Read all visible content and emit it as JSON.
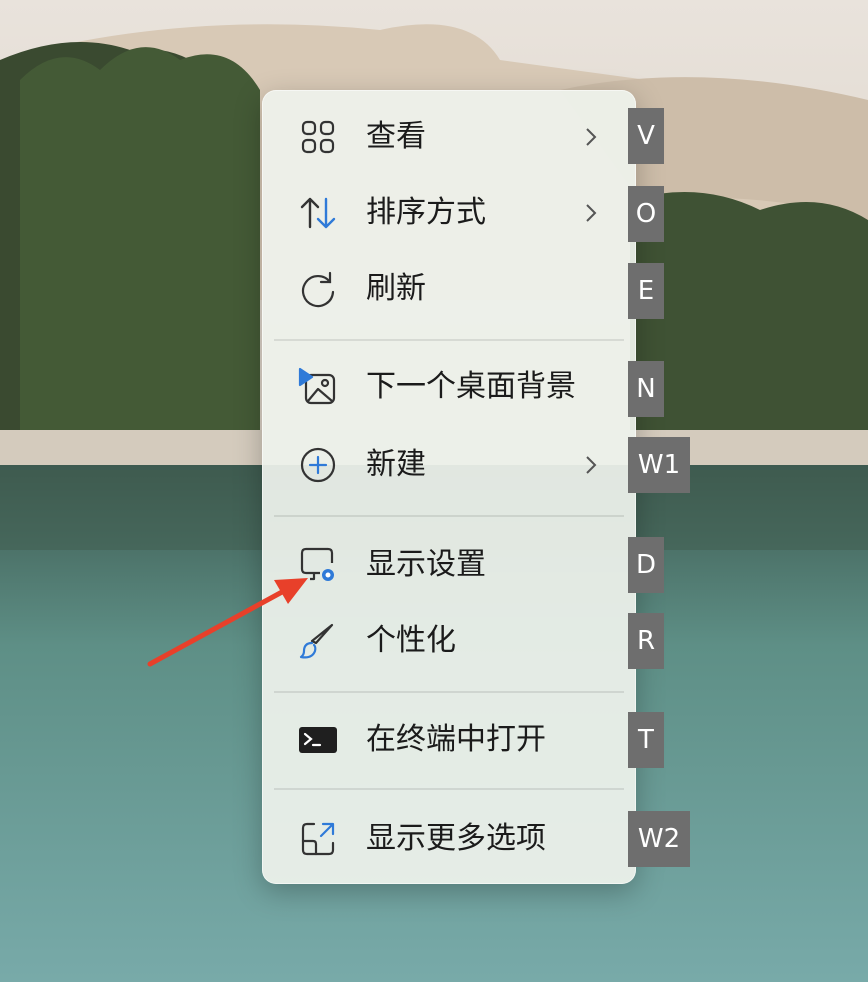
{
  "menu": {
    "items": [
      {
        "label": "查看",
        "icon": "grid-view-icon",
        "submenu": true,
        "key": "V"
      },
      {
        "label": "排序方式",
        "icon": "sort-icon",
        "submenu": true,
        "key": "O"
      },
      {
        "label": "刷新",
        "icon": "refresh-icon",
        "submenu": false,
        "key": "E"
      },
      {
        "label": "下一个桌面背景",
        "icon": "next-background-icon",
        "submenu": false,
        "key": "N"
      },
      {
        "label": "新建",
        "icon": "new-plus-icon",
        "submenu": true,
        "key": "W1"
      },
      {
        "label": "显示设置",
        "icon": "display-settings-icon",
        "submenu": false,
        "key": "D"
      },
      {
        "label": "个性化",
        "icon": "paintbrush-icon",
        "submenu": false,
        "key": "R"
      },
      {
        "label": "在终端中打开",
        "icon": "terminal-icon",
        "submenu": false,
        "key": "T"
      },
      {
        "label": "显示更多选项",
        "icon": "more-options-icon",
        "submenu": false,
        "key": "W2"
      }
    ]
  },
  "colors": {
    "accent": "#2f7ad8",
    "arrow": "#e8402a",
    "key_badge": "#6e6e6e"
  }
}
